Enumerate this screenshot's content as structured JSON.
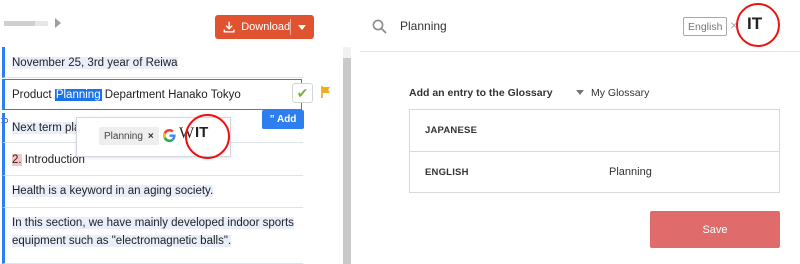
{
  "toolbar": {
    "progress_fraction": 0.7,
    "download_label": "Download"
  },
  "segments": {
    "s1": "November 25, 3rd year of Reiwa",
    "edit": {
      "before": "Product ",
      "highlight": "Planning",
      "after": " Department Hanako Tokyo"
    },
    "s3": "Next term pla",
    "s4": {
      "num": "2.",
      "rest": " Introduction"
    },
    "s5": "Health is a keyword in an aging society.",
    "s6_line1": "In this section, we have mainly developed indoor sports",
    "s6_line2": "equipment such as \"electromagnetic balls\"."
  },
  "popup": {
    "term_chip": "Planning",
    "chip_remove": "×",
    "google_icon": "G",
    "wiki_icon": "W",
    "tt_icon": "T"
  },
  "add_button": "” Add",
  "right": {
    "search_value": "Planning",
    "language_badge": "English",
    "clear": "×",
    "tt_icon": "T",
    "glossary_label": "Add an entry to the Glossary",
    "glossary_select": "My Glossary",
    "rows": [
      {
        "label": "JAPANESE",
        "value": ""
      },
      {
        "label": "ENGLISH",
        "value": "Planning"
      }
    ],
    "save_label": "Save"
  },
  "colors": {
    "accent_blue": "#2d7ff0",
    "download_red": "#e15230",
    "save_red": "#e06b6b",
    "annotation_circle": "#e11111"
  }
}
